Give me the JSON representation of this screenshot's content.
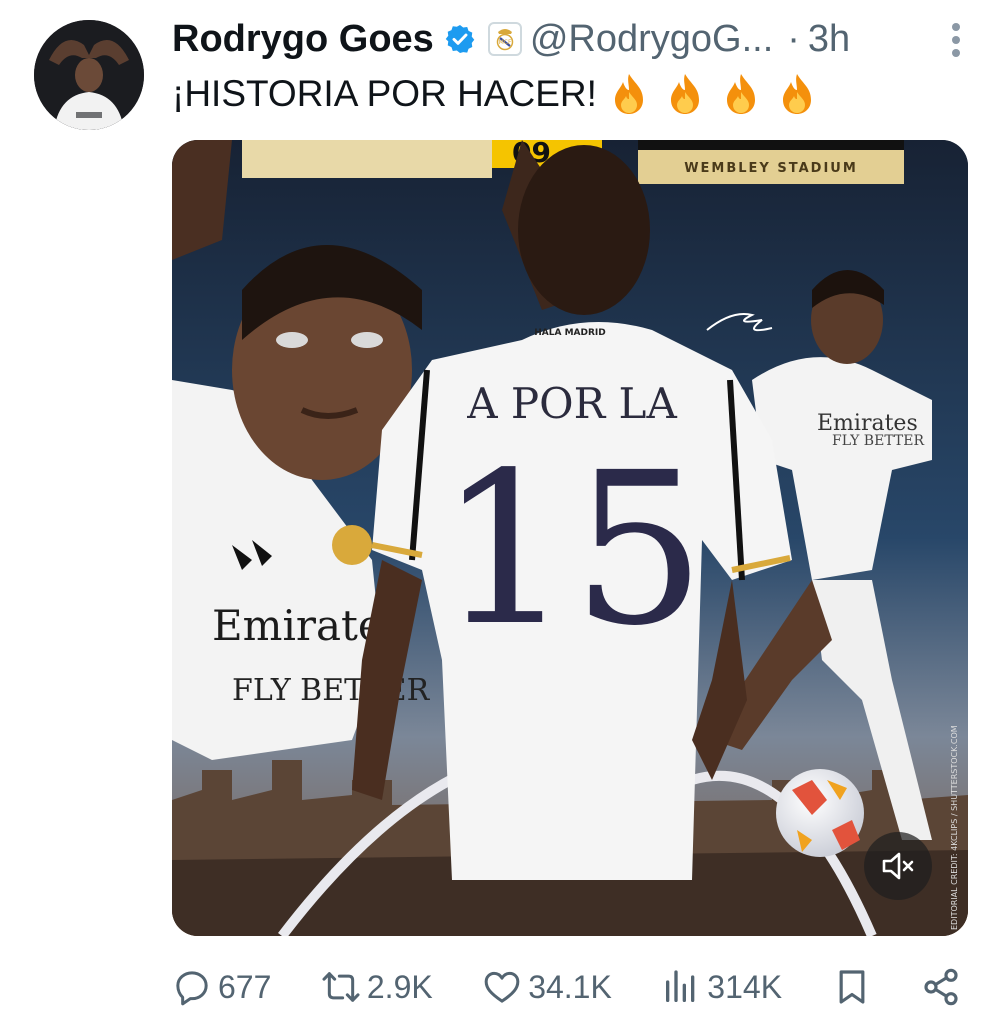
{
  "tweet": {
    "author_name": "Rodrygo Goes",
    "handle": "@RodrygoG...",
    "separator": "·",
    "time": "3h",
    "text": "¡HISTORIA POR HACER!",
    "emojis": [
      "fire",
      "fire",
      "fire",
      "fire"
    ]
  },
  "media": {
    "jersey_text": "A POR LA",
    "jersey_number": "15",
    "venue_label": "WEMBLEY STADIUM",
    "collar_text": "HALA MADRID",
    "sponsor_line1": "Emirates",
    "sponsor_line2": "FLY BETTER",
    "credit": "EDITORIAL CREDIT: 4KCLIPS / SHUTTERSTOCK.COM",
    "audio_state": "muted"
  },
  "actions": {
    "replies": "677",
    "reposts": "2.9K",
    "likes": "34.1K",
    "views": "314K"
  },
  "icons": {
    "verified": "verified-badge-icon",
    "affiliation": "real-madrid-crest-icon",
    "more": "more-options-icon",
    "reply": "reply-icon",
    "repost": "repost-icon",
    "like": "heart-icon",
    "views": "views-icon",
    "bookmark": "bookmark-icon",
    "share": "share-icon",
    "mute": "speaker-muted-icon"
  },
  "colors": {
    "verified_blue": "#1d9bf0",
    "secondary_text": "#536471",
    "primary_text": "#0f1419"
  }
}
